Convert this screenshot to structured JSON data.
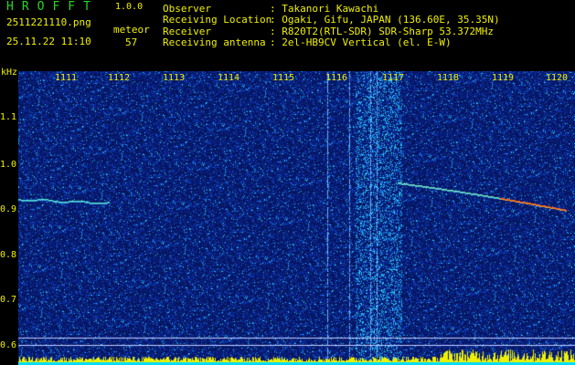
{
  "header": {
    "logo": "HROFFT",
    "version": "1.0.0",
    "filename": "2511221110.png",
    "datetime": "25.11.22 11:10",
    "meteor_label": "meteor",
    "meteor_count": "57"
  },
  "info": [
    {
      "key": "Observer",
      "value": ": Takanori Kawachi"
    },
    {
      "key": "Receiving Location",
      "value": ": Ogaki, Gifu, JAPAN (136.60E, 35.35N)"
    },
    {
      "key": "Receiver",
      "value": ": R820T2(RTL-SDR) SDR-Sharp 53.372MHz"
    },
    {
      "key": "Receiving antenna",
      "value": ": 2el-HB9CV Vertical (el. E-W)"
    }
  ],
  "axes": {
    "y_unit": "kHz",
    "y_ticks": [
      "1.1",
      "1.0",
      "0.9",
      "0.8",
      "0.7",
      "0.6"
    ],
    "x_ticks": [
      "1111",
      "1112",
      "1113",
      "1114",
      "1115",
      "1116",
      "1117",
      "1118",
      "1119",
      "1120"
    ]
  },
  "colors": {
    "background": "#06145a",
    "text": "#f0f000",
    "logo": "#23d823",
    "baseline": "#00dcff"
  }
}
